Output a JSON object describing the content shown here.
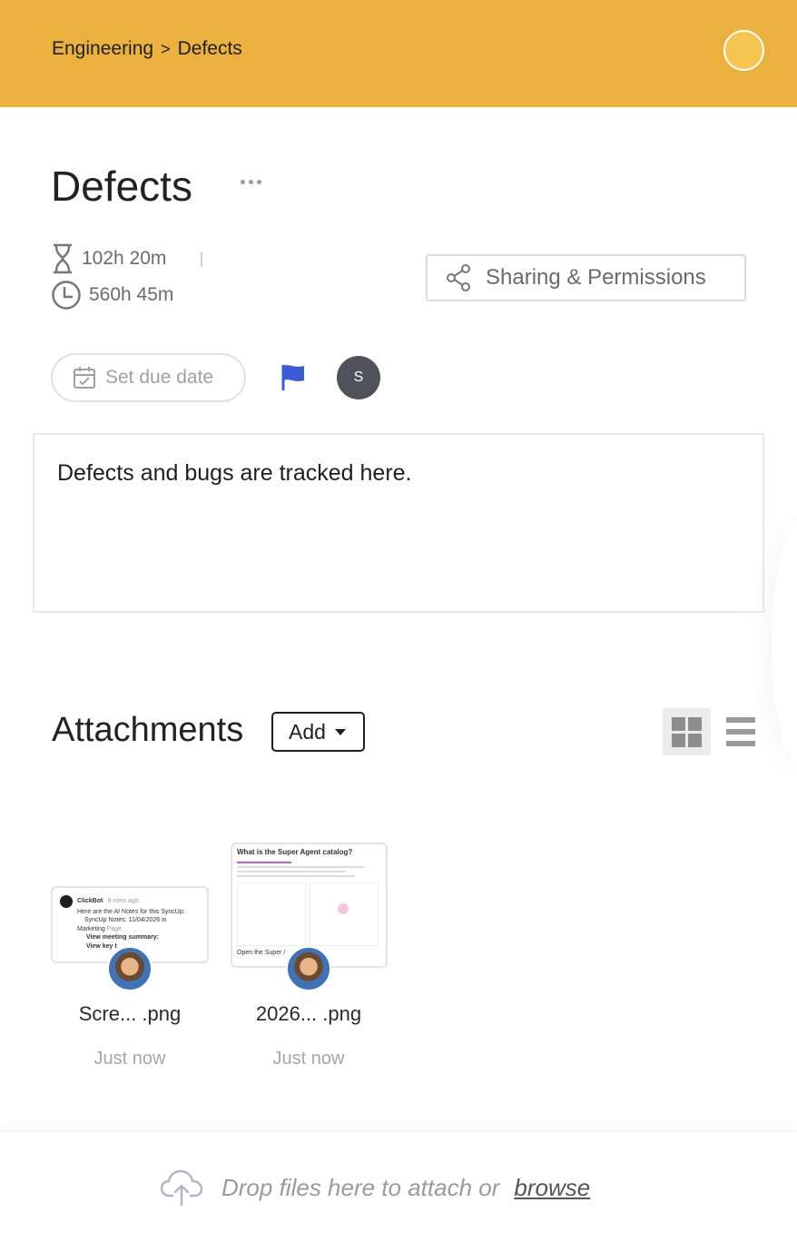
{
  "header": {
    "breadcrumb_parent": "Engineering",
    "breadcrumb_separator": ">",
    "breadcrumb_current": "Defects",
    "accent_color": "#ebb13f"
  },
  "page": {
    "title": "Defects"
  },
  "time": {
    "tracked": "102h 20m",
    "estimated": "560h 45m"
  },
  "sharing": {
    "label": "Sharing & Permissions"
  },
  "due_date": {
    "label": "Set due date"
  },
  "priority": {
    "flag_color": "#3b5bd6"
  },
  "assignee": {
    "initial": "S"
  },
  "description": {
    "text": "Defects and bugs are tracked here."
  },
  "attachments": {
    "title": "Attachments",
    "add_label": "Add",
    "items": [
      {
        "name": "Scre...  .png",
        "time": "Just now",
        "preview": {
          "sender": "ClickBot",
          "ago": "9 mins ago",
          "line1": "Here are the AI Notes for this SyncUp:",
          "line2": "SyncUp Notes: 11/04/2026 in",
          "line3": "Marketing",
          "line3_suffix": "Page",
          "line4": "View meeting summary:",
          "line5": "View key t"
        }
      },
      {
        "name": "2026... .png",
        "time": "Just now",
        "preview": {
          "heading": "What is the Super Agent catalog?",
          "footer": "Open the Super /"
        }
      }
    ]
  },
  "dropzone": {
    "text": "Drop files here to attach or",
    "browse": "browse"
  }
}
